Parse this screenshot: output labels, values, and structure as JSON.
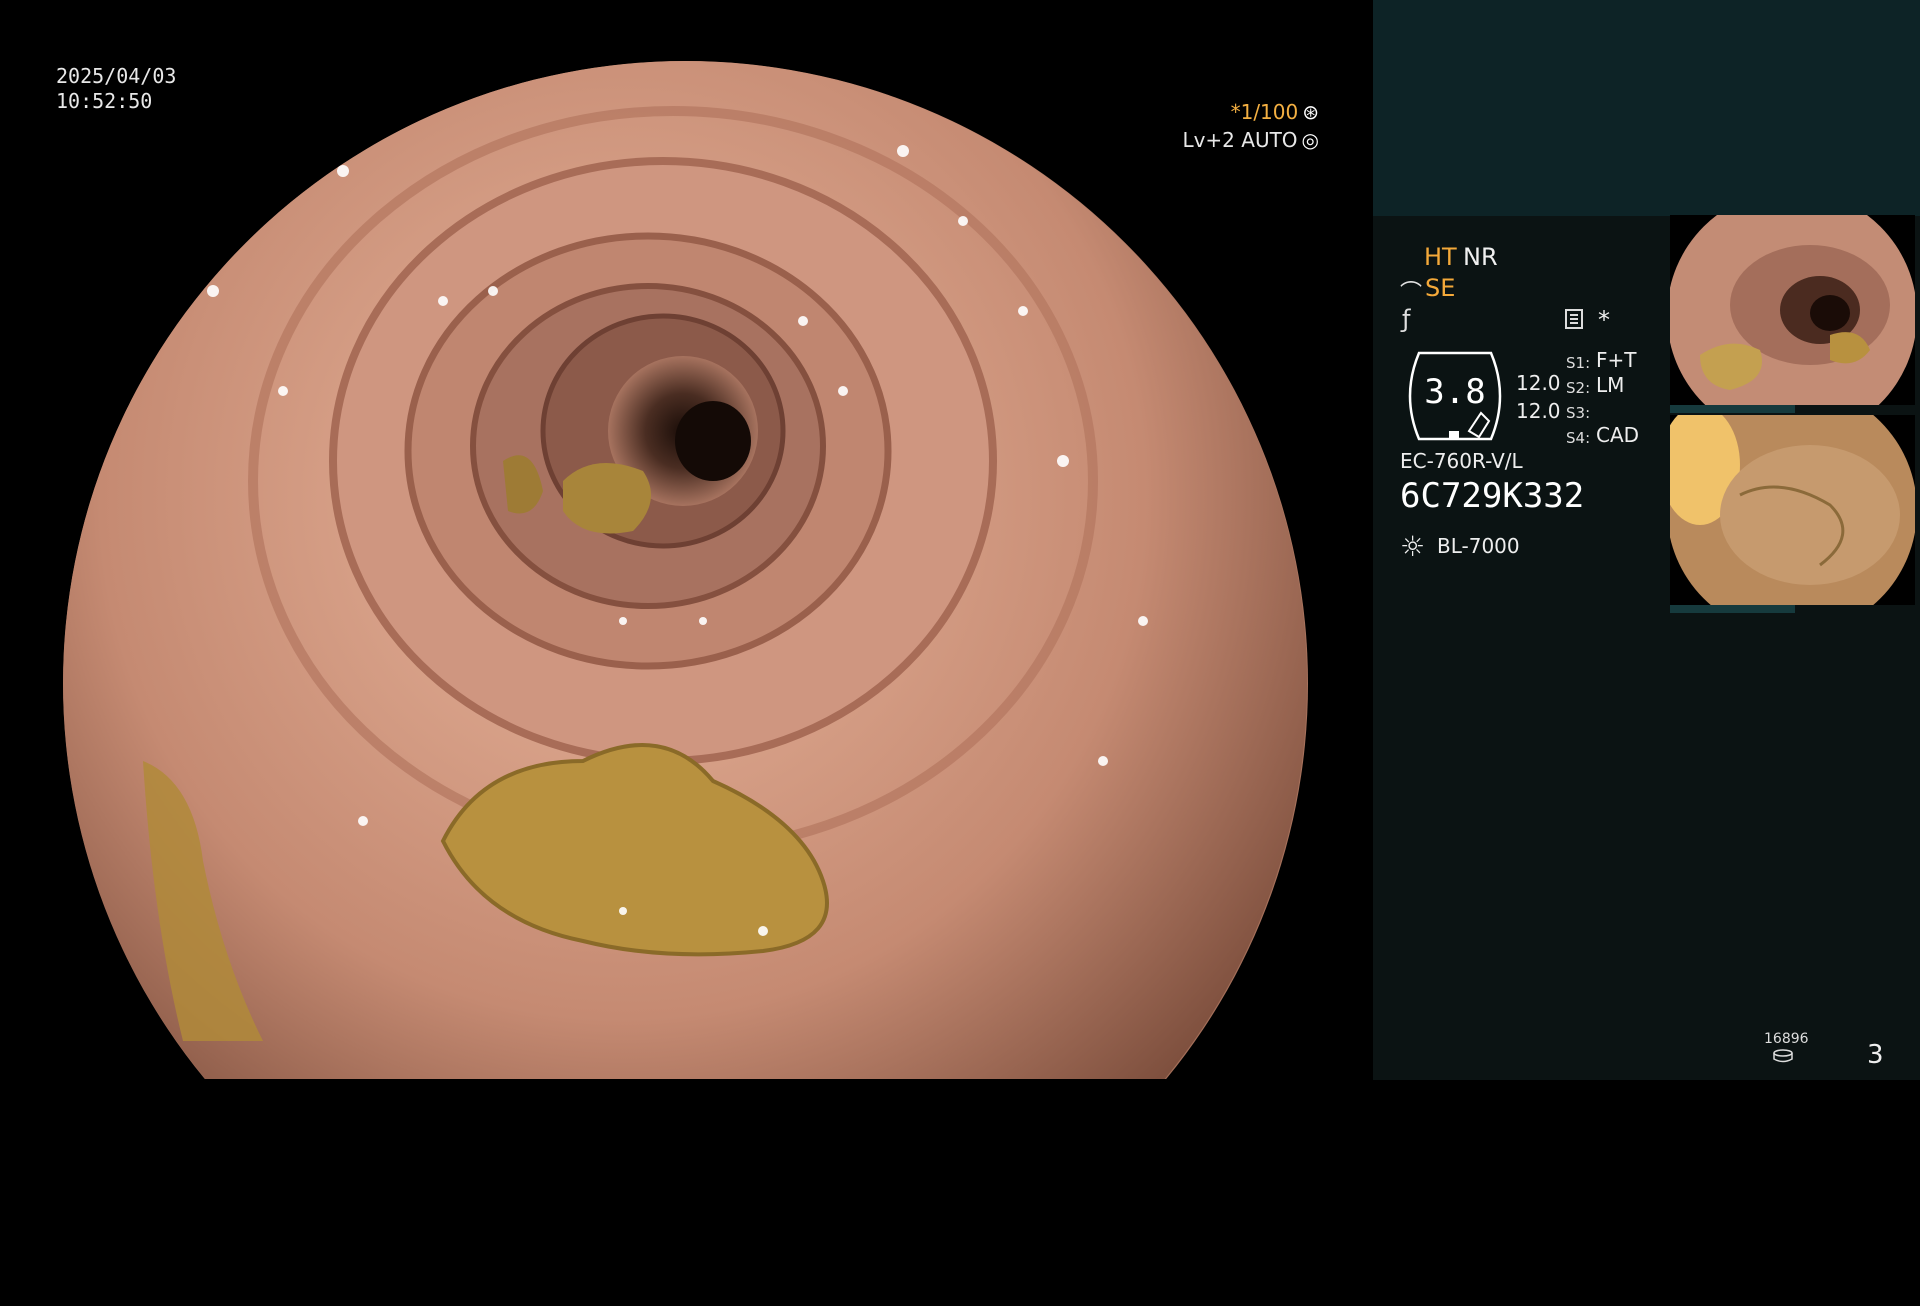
{
  "overlay": {
    "date": "2025/04/03",
    "time": "10:52:50",
    "shutter": "*1/100",
    "shutter_icon": "aperture-icon",
    "level": "Lv+2 AUTO",
    "level_icon": "iris-icon"
  },
  "panel": {
    "ht": "HT",
    "nr": "NR",
    "se": "SE",
    "ratio": "3.8",
    "value_a": "12.0",
    "value_b": "12.0",
    "settings": [
      {
        "key": "S1:",
        "value": "F+T"
      },
      {
        "key": "S2:",
        "value": "LM"
      },
      {
        "key": "S3:",
        "value": ""
      },
      {
        "key": "S4:",
        "value": "CAD"
      }
    ],
    "scope_model": "EC-760R-V/L",
    "scope_serial": "6C729K332",
    "light_source": "BL-7000",
    "star": "*"
  },
  "footer": {
    "capture_count": "16896",
    "page_number": "3"
  },
  "colors": {
    "accent_orange": "#f4a93a",
    "panel_bg": "#0b1313",
    "panel_top_bg": "#0d2326"
  }
}
